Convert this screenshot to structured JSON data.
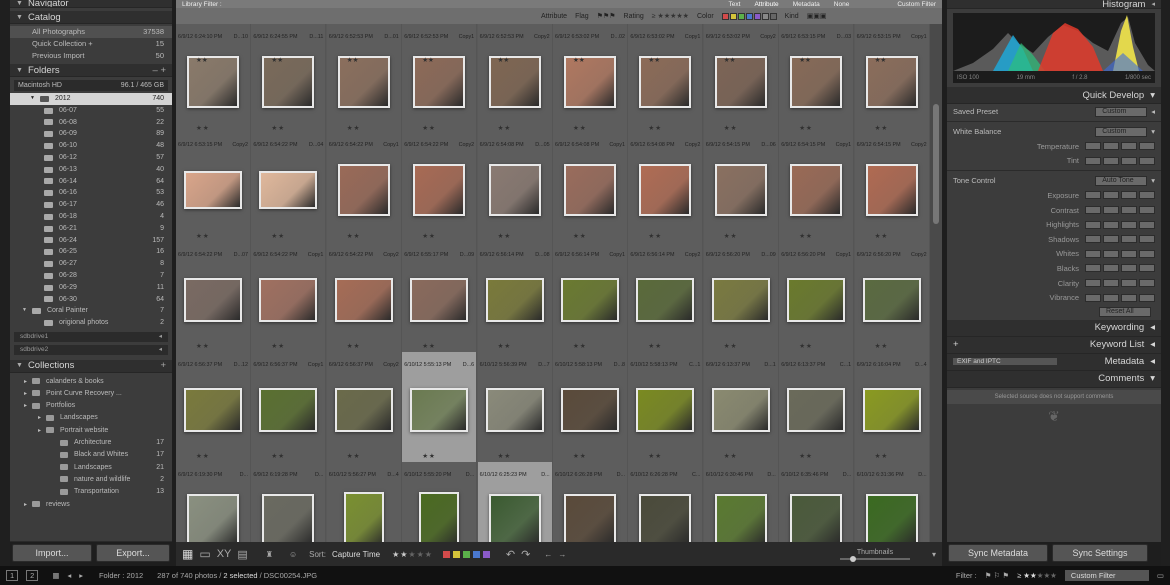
{
  "navigator_title": "Navigator",
  "catalog": {
    "title": "Catalog",
    "items": [
      {
        "label": "All Photographs",
        "count": "37538"
      },
      {
        "label": "Quick Collection +",
        "count": "15"
      },
      {
        "label": "Previous Import",
        "count": "50"
      }
    ]
  },
  "folders": {
    "title": "Folders",
    "volume": {
      "name": "Macintosh HD",
      "space": "96.1 / 465 GB"
    },
    "items": [
      {
        "label": "2012",
        "count": "740",
        "level": 1,
        "selected": true
      },
      {
        "label": "06-07",
        "count": "55",
        "level": 2
      },
      {
        "label": "06-08",
        "count": "22",
        "level": 2
      },
      {
        "label": "06-09",
        "count": "89",
        "level": 2
      },
      {
        "label": "06-10",
        "count": "48",
        "level": 2
      },
      {
        "label": "06-12",
        "count": "57",
        "level": 2
      },
      {
        "label": "06-13",
        "count": "40",
        "level": 2
      },
      {
        "label": "06-14",
        "count": "64",
        "level": 2
      },
      {
        "label": "06-16",
        "count": "53",
        "level": 2
      },
      {
        "label": "06-17",
        "count": "46",
        "level": 2
      },
      {
        "label": "06-18",
        "count": "4",
        "level": 2
      },
      {
        "label": "06-21",
        "count": "9",
        "level": 2
      },
      {
        "label": "06-24",
        "count": "157",
        "level": 2
      },
      {
        "label": "06-25",
        "count": "16",
        "level": 2
      },
      {
        "label": "06-27",
        "count": "8",
        "level": 2
      },
      {
        "label": "06-28",
        "count": "7",
        "level": 2
      },
      {
        "label": "06-29",
        "count": "11",
        "level": 2
      },
      {
        "label": "06-30",
        "count": "64",
        "level": 2
      },
      {
        "label": "Coral Painter",
        "count": "7",
        "level": 0
      },
      {
        "label": "origional photos",
        "count": "2",
        "level": 2
      }
    ],
    "offline": [
      {
        "name": "sdbdrive1",
        "mark": "◂"
      },
      {
        "name": "sdbdrive2",
        "mark": "◂"
      }
    ]
  },
  "collections": {
    "title": "Collections",
    "items": [
      {
        "label": "calanders & books",
        "count": "",
        "level": 1
      },
      {
        "label": "Point Curve Recovery ...",
        "count": "",
        "level": 1
      },
      {
        "label": "Portfolios",
        "count": "",
        "level": 1
      },
      {
        "label": "Landscapes",
        "count": "",
        "level": 2
      },
      {
        "label": "Portrait website",
        "count": "",
        "level": 2
      },
      {
        "label": "Architecture",
        "count": "17",
        "level": 3
      },
      {
        "label": "Black and Whites",
        "count": "17",
        "level": 3
      },
      {
        "label": "Landscapes",
        "count": "21",
        "level": 3
      },
      {
        "label": "nature and wildlife",
        "count": "2",
        "level": 3
      },
      {
        "label": "Transportation",
        "count": "13",
        "level": 3
      },
      {
        "label": "reviews",
        "count": "",
        "level": 1
      }
    ]
  },
  "left_buttons": {
    "import": "Import...",
    "export": "Export..."
  },
  "filter_bar": {
    "title": "Library Filter :",
    "tabs": [
      "Text",
      "Attribute",
      "Metadata",
      "None"
    ],
    "custom": "Custom Filter",
    "attribute_label": "Attribute",
    "flag_label": "Flag",
    "rating_label": "Rating",
    "color_label": "Color",
    "kind_label": "Kind"
  },
  "grid_rows": [
    [
      {
        "t": "6/9/12 6:24:10 PM",
        "x": "D...10",
        "c": "#8a7a6a"
      },
      {
        "t": "6/9/12 6:24:55 PM",
        "x": "D...11",
        "c": "#7a6a5a"
      },
      {
        "t": "6/9/12 6:52:53 PM",
        "x": "D...01",
        "c": "#8b6f5d"
      },
      {
        "t": "6/9/12 6:52:53 PM",
        "x": "Copy1",
        "c": "#8d6a58"
      },
      {
        "t": "6/9/12 6:52:53 PM",
        "x": "Copy2",
        "c": "#7f6652"
      },
      {
        "t": "6/9/12 6:53:02 PM",
        "x": "D...02",
        "c": "#b07860"
      },
      {
        "t": "6/9/12 6:53:02 PM",
        "x": "Copy1",
        "c": "#8c6b58"
      },
      {
        "t": "6/9/12 6:53:02 PM",
        "x": "Copy2",
        "c": "#7d6455"
      },
      {
        "t": "6/9/12 6:53:15 PM",
        "x": "D...03",
        "c": "#876a57"
      },
      {
        "t": "6/9/12 6:53:15 PM",
        "x": "Copy1",
        "c": "#8b6d5b"
      }
    ],
    [
      {
        "t": "6/9/12 6:53:15 PM",
        "x": "Copy2",
        "c": "#d9a58a"
      },
      {
        "t": "6/9/12 6:54:22 PM",
        "x": "D...04",
        "c": "#e0b89c"
      },
      {
        "t": "6/9/12 6:54:22 PM",
        "x": "Copy1",
        "c": "#9a6a58"
      },
      {
        "t": "6/9/12 6:54:22 PM",
        "x": "Copy2",
        "c": "#a86a54"
      },
      {
        "t": "6/9/12 6:54:08 PM",
        "x": "D...05",
        "c": "#8a7a72"
      },
      {
        "t": "6/9/12 6:54:08 PM",
        "x": "Copy1",
        "c": "#9a6c5c"
      },
      {
        "t": "6/9/12 6:54:08 PM",
        "x": "Copy2",
        "c": "#b06c54"
      },
      {
        "t": "6/9/12 6:54:15 PM",
        "x": "D...06",
        "c": "#8a7060"
      },
      {
        "t": "6/9/12 6:54:15 PM",
        "x": "Copy1",
        "c": "#9a6a56"
      },
      {
        "t": "6/9/12 6:54:15 PM",
        "x": "Copy2",
        "c": "#b06a52"
      }
    ],
    [
      {
        "t": "6/9/12 6:54:22 PM",
        "x": "D...07",
        "c": "#7a6a62"
      },
      {
        "t": "6/9/12 6:54:22 PM",
        "x": "Copy1",
        "c": "#a07060"
      },
      {
        "t": "6/9/12 6:54:22 PM",
        "x": "Copy2",
        "c": "#a66c56"
      },
      {
        "t": "6/9/12 6:55:17 PM",
        "x": "D...09",
        "c": "#8a6a5c"
      },
      {
        "t": "6/9/12 6:56:14 PM",
        "x": "D...08",
        "c": "#7a7a3a"
      },
      {
        "t": "6/9/12 6:56:14 PM",
        "x": "Copy1",
        "c": "#6a7a30"
      },
      {
        "t": "6/9/12 6:56:14 PM",
        "x": "Copy2",
        "c": "#5a6a3a"
      },
      {
        "t": "6/9/12 6:56:20 PM",
        "x": "D...09",
        "c": "#7a7a40"
      },
      {
        "t": "6/9/12 6:56:20 PM",
        "x": "Copy1",
        "c": "#6a7a2c"
      },
      {
        "t": "6/9/12 6:56:20 PM",
        "x": "Copy2",
        "c": "#5a6a40"
      }
    ],
    [
      {
        "t": "6/9/12 6:56:37 PM",
        "x": "D...12",
        "c": "#7a7a3c"
      },
      {
        "t": "6/9/12 6:56:37 PM",
        "x": "Copy1",
        "c": "#5a7030"
      },
      {
        "t": "6/9/12 6:56:37 PM",
        "x": "Copy2",
        "c": "#6a6a4a"
      },
      {
        "t": "6/10/12 5:55:13 PM",
        "x": "D...6",
        "c": "#6a7a50"
      },
      {
        "t": "6/10/12 5:56:39 PM",
        "x": "D...7",
        "c": "#8a8a7a"
      },
      {
        "t": "6/10/12 5:58:13 PM",
        "x": "D...8",
        "c": "#5a4a3a"
      },
      {
        "t": "6/10/12 5:58:13 PM",
        "x": "C...1",
        "c": "#7a8a20"
      },
      {
        "t": "6/9/12 6:13:37 PM",
        "x": "D...1",
        "c": "#8a8a70"
      },
      {
        "t": "6/9/12 6:13:37 PM",
        "x": "C...1",
        "c": "#6a6a5a"
      },
      {
        "t": "6/9/12 6:16:04 PM",
        "x": "D...4",
        "c": "#8a9a20"
      }
    ],
    [
      {
        "t": "6/9/12 6:19:30 PM",
        "x": "D...",
        "c": "#8a9080"
      },
      {
        "t": "6/9/12 6:19:28 PM",
        "x": "D...",
        "c": "#6a6a60"
      },
      {
        "t": "6/10/12 5:56:27 PM",
        "x": "D...4",
        "c": "#7a9030"
      },
      {
        "t": "6/10/12 5:55:20 PM",
        "x": "D...",
        "c": "#4a6a20"
      },
      {
        "t": "6/10/12 6:25:23 PM",
        "x": "D...",
        "c": "#3a5a30"
      },
      {
        "t": "6/10/12 6:26:28 PM",
        "x": "D...",
        "c": "#5a4a3a"
      },
      {
        "t": "6/10/12 6:26:28 PM",
        "x": "C...",
        "c": "#4a4a3a"
      },
      {
        "t": "6/10/12 6:30:46 PM",
        "x": "D...",
        "c": "#5a7a30"
      },
      {
        "t": "6/10/12 6:35:46 PM",
        "x": "D...",
        "c": "#4a5a3a"
      },
      {
        "t": "6/10/12 6:31:36 PM",
        "x": "D...",
        "c": "#3a6a20"
      }
    ]
  ],
  "toolbar": {
    "sort_label": "Sort:",
    "sort_value": "Capture Time",
    "thumbnails_label": "Thumbnails",
    "label_colors": [
      "#d24b4b",
      "#d4c43a",
      "#5bb14a",
      "#4a78cf",
      "#8a5ac8"
    ]
  },
  "right_panel": {
    "histogram_title": "Histogram",
    "histogram_info": {
      "iso": "ISO 100",
      "focal": "19 mm",
      "aperture": "f / 2.8",
      "shutter": "1/800 sec"
    },
    "quick_develop_title": "Quick Develop",
    "saved_preset_label": "Saved Preset",
    "saved_preset_value": "Custom",
    "white_balance_label": "White Balance",
    "white_balance_value": "Custom",
    "temperature_label": "Temperature",
    "tint_label": "Tint",
    "tone_control_label": "Tone Control",
    "auto_tone_label": "Auto Tone",
    "exposure_label": "Exposure",
    "contrast_label": "Contrast",
    "highlights_label": "Highlights",
    "shadows_label": "Shadows",
    "whites_label": "Whites",
    "blacks_label": "Blacks",
    "clarity_label": "Clarity",
    "vibrance_label": "Vibrance",
    "reset_label": "Reset All",
    "keywording_title": "Keywording",
    "keyword_list_title": "Keyword List",
    "metadata_title": "Metadata",
    "metadata_preset": "EXIF and IPTC",
    "comments_title": "Comments",
    "comments_text": "Selected source does not support comments",
    "sync_metadata": "Sync Metadata",
    "sync_settings": "Sync Settings"
  },
  "bottom_bar": {
    "folder_label": "Folder : 2012",
    "count_text": "287 of 740 photos /",
    "selected_text": "2 selected",
    "filename": "/ DSC00254.JPG",
    "filter_label": "Filter :",
    "custom_filter": "Custom Filter"
  }
}
